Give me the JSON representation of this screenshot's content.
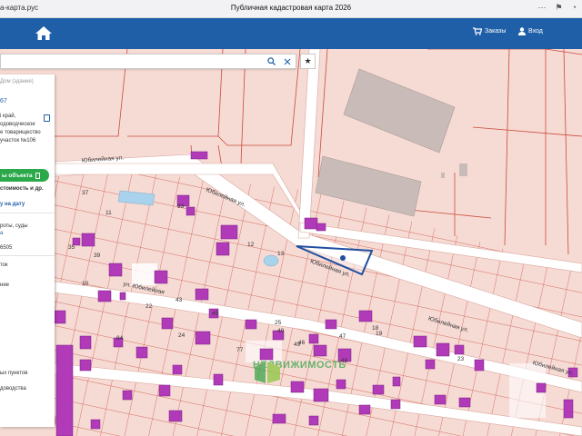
{
  "browser": {
    "url": "а-карта.рус",
    "title": "Публичная кадастровая карта 2026"
  },
  "header": {
    "orders_label": "Заказы",
    "login_label": "Вход"
  },
  "search": {
    "value": "",
    "placeholder": ""
  },
  "panel": {
    "line1": "Дом (здание)",
    "line2": "67",
    "line3": "і край,",
    "line4": "одоводческое",
    "line5": "е товарищество",
    "line6": "участок №106",
    "action_button": "ы объекта",
    "line7": "стоимость и др.",
    "line8": "у на дату",
    "line9": "роты, суды",
    "line10": "а",
    "line11": "6505",
    "line12": "ток",
    "line13": "ние",
    "line14": "ых пунктов",
    "line15": "доводства"
  },
  "map": {
    "street_labels": [
      "Юбилейная ул.",
      "Юбилейная ул.",
      "Юбилейная ул.",
      "Юбилейная ул.",
      "ул. Юбилейная",
      "Юбилейная ул."
    ],
    "parcel_numbers": [
      "37",
      "11",
      "93",
      "12",
      "35",
      "39",
      "10",
      "13",
      "43",
      "45",
      "24",
      "25",
      "46",
      "40",
      "47",
      "48",
      "19",
      "23",
      "22",
      "77",
      "49",
      "84",
      "18"
    ],
    "watermark": "НЕДВИЖИМОСТЬ",
    "colors": {
      "parcel_fill": "#f6dad4",
      "parcel_border": "#c0392b",
      "building": "#b03ab8",
      "road": "#ffffff",
      "selection": "#1f4fa0",
      "accent": "#1f5fa8",
      "green": "#2aa84a"
    }
  }
}
